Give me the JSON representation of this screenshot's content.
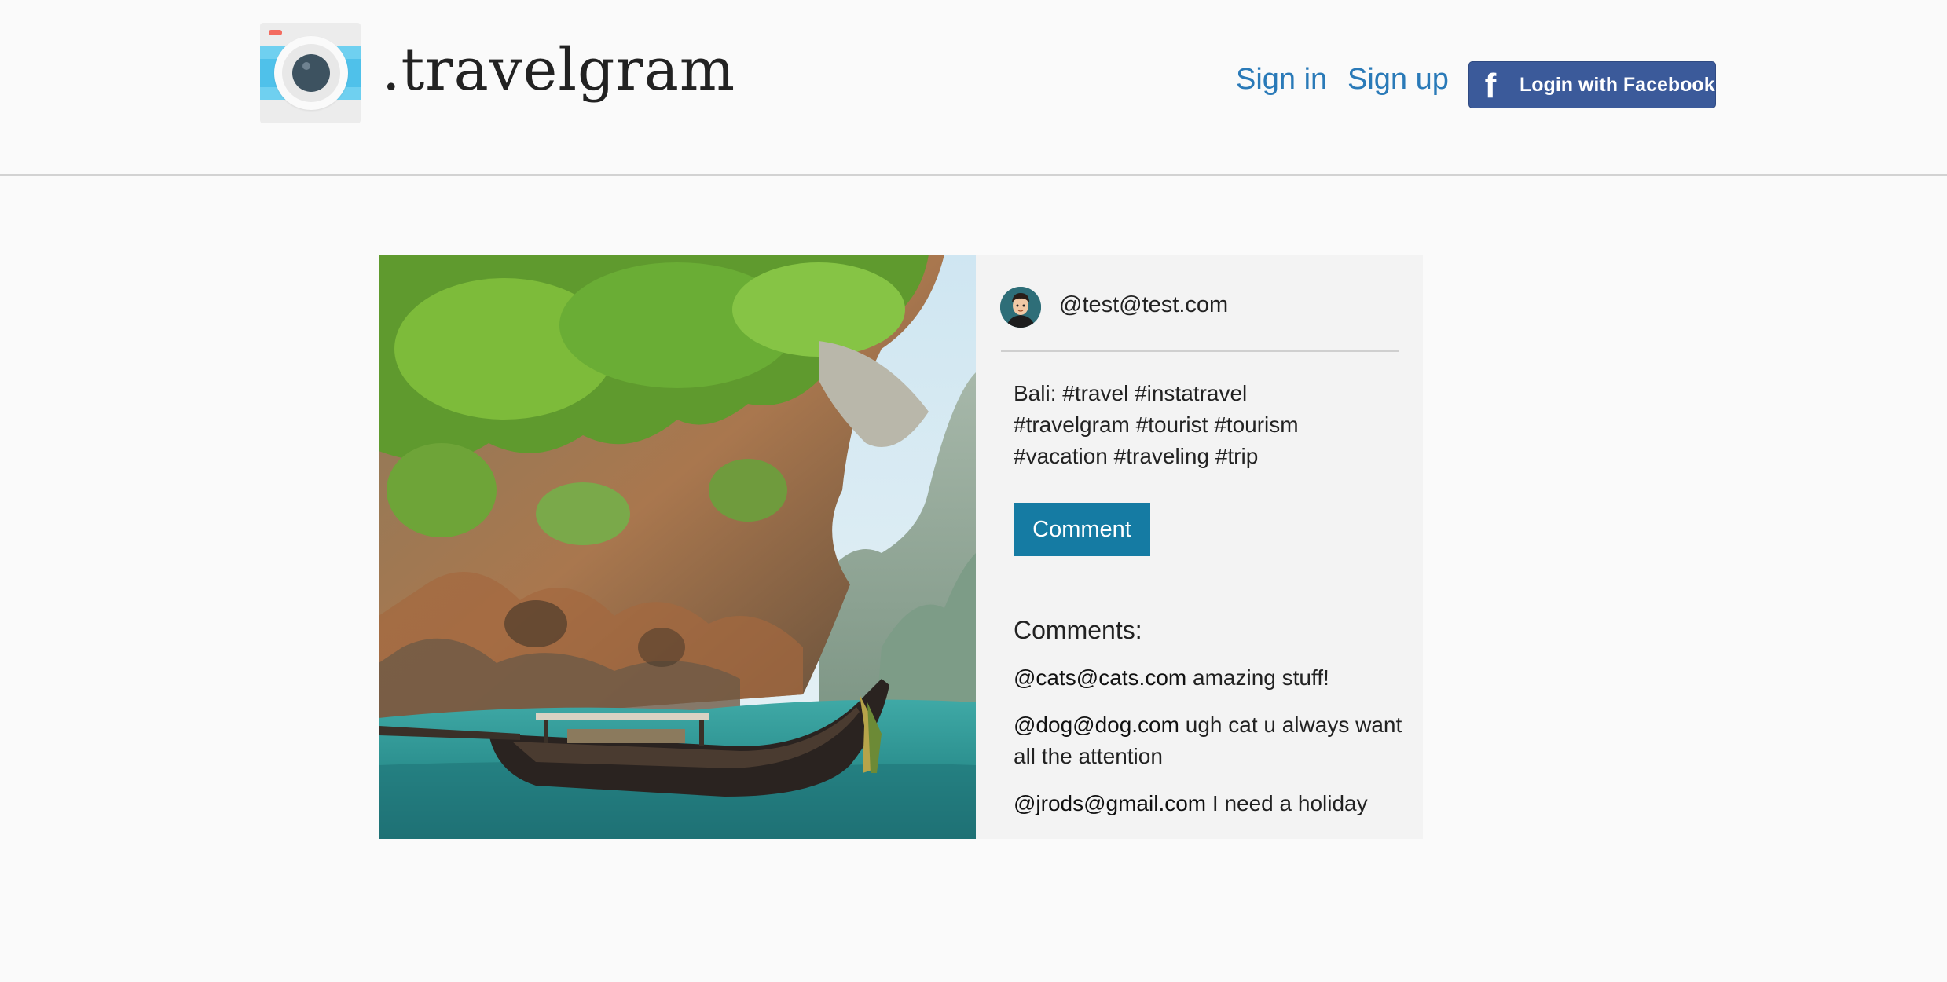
{
  "app": {
    "brand": ".travelgram"
  },
  "nav": {
    "sign_in": "Sign in",
    "sign_up": "Sign up",
    "facebook_login": "Login with Facebook",
    "facebook_glyph": "f"
  },
  "colors": {
    "link": "#2a7ab8",
    "facebook": "#3b5a9a",
    "comment_button": "#157ba3",
    "panel_background": "#f3f3f3"
  },
  "icons": {
    "logo": "camera-logo-icon",
    "facebook": "facebook-icon",
    "avatar": "user-avatar"
  },
  "post": {
    "username": "@test@test.com",
    "caption_lines": [
      "Bali: #travel #instatravel",
      "#travelgram #tourist #tourism",
      "#vacation #traveling #trip"
    ],
    "comment_button": "Comment",
    "comments_heading": "Comments:",
    "comments": [
      {
        "author": "@cats@cats.com",
        "text": "amazing stuff!"
      },
      {
        "author": "@dog@dog.com",
        "text": "ugh cat u always want all the attention"
      },
      {
        "author": "@jrods@gmail.com",
        "text": "I need a holiday"
      }
    ]
  }
}
